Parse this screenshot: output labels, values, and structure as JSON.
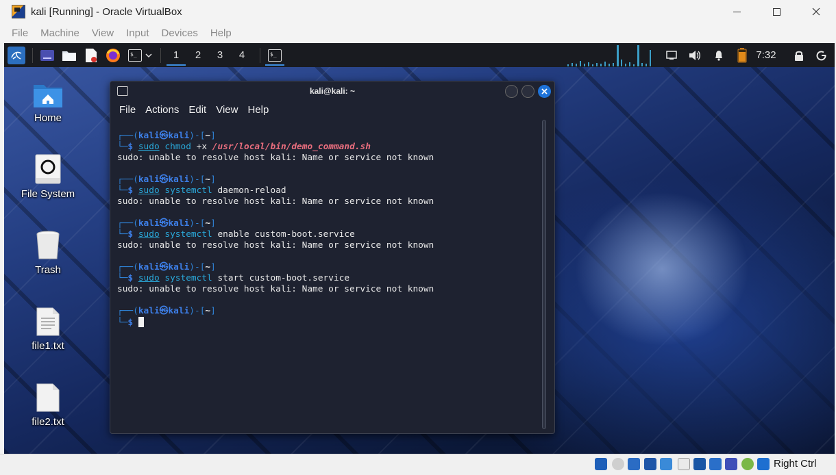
{
  "host": {
    "title": "kali [Running] - Oracle VirtualBox",
    "menu": [
      "File",
      "Machine",
      "View",
      "Input",
      "Devices",
      "Help"
    ],
    "host_key": "Right Ctrl"
  },
  "panel": {
    "workspaces": [
      "1",
      "2",
      "3",
      "4"
    ],
    "active_workspace": "1",
    "clock": "7:32"
  },
  "desktop": {
    "icons": [
      {
        "label": "Home",
        "icon": "home-folder-icon"
      },
      {
        "label": "File System",
        "icon": "drive-icon"
      },
      {
        "label": "Trash",
        "icon": "trash-icon"
      },
      {
        "label": "file1.txt",
        "icon": "text-file-icon"
      },
      {
        "label": "file2.txt",
        "icon": "blank-file-icon"
      }
    ]
  },
  "terminal": {
    "title": "kali@kali: ~",
    "menu": [
      "File",
      "Actions",
      "Edit",
      "View",
      "Help"
    ],
    "prompt": {
      "user": "kali",
      "host": "kali",
      "dir": "~"
    },
    "blocks": [
      {
        "sudo": "sudo",
        "exe": "chmod",
        "args": "+x",
        "path": "/usr/local/bin/demo_command.sh",
        "output": "sudo: unable to resolve host kali: Name or service not known"
      },
      {
        "sudo": "sudo",
        "exe": "systemctl",
        "args": "daemon-reload",
        "path": "",
        "output": "sudo: unable to resolve host kali: Name or service not known"
      },
      {
        "sudo": "sudo",
        "exe": "systemctl",
        "args": "enable custom-boot.service",
        "path": "",
        "output": "sudo: unable to resolve host kali: Name or service not known"
      },
      {
        "sudo": "sudo",
        "exe": "systemctl",
        "args": "start custom-boot.service",
        "path": "",
        "output": "sudo: unable to resolve host kali: Name or service not known"
      }
    ]
  },
  "colors": {
    "panel_bg": "#191b20",
    "terminal_bg": "#1e2230",
    "prompt_blue": "#3d7fe8",
    "command_cyan": "#2aa7d8",
    "path_pink": "#ea6e7e",
    "close_button": "#1e73d9"
  }
}
